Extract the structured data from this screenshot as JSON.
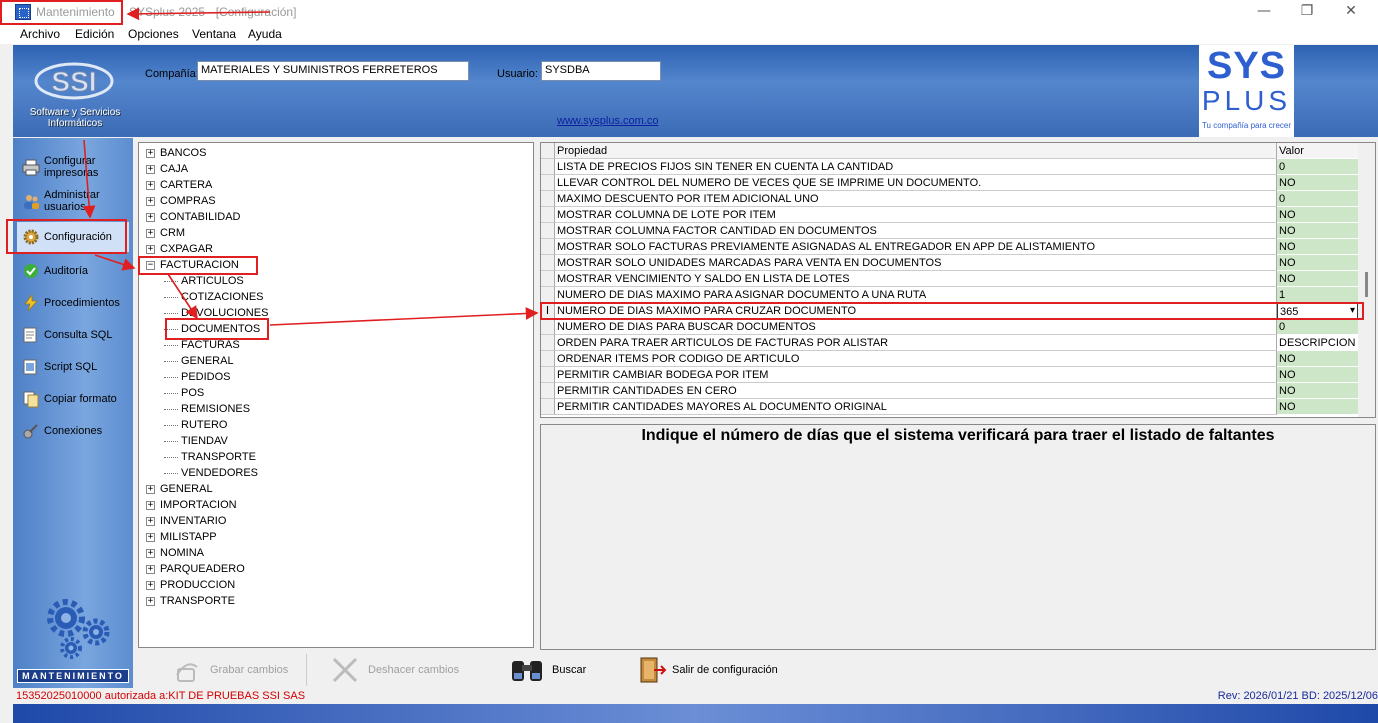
{
  "window": {
    "title_app": "Mantenimiento",
    "title_rest": "SYSplus 2025 - [Configuración]",
    "minimize": "—",
    "maximize": "❐",
    "close": "✕"
  },
  "menu": [
    "Archivo",
    "Edición",
    "Opciones",
    "Ventana",
    "Ayuda"
  ],
  "header": {
    "company_label": "Compañía:",
    "company_value": "MATERIALES Y SUMINISTROS FERRETEROS",
    "user_label": "Usuario:",
    "user_value": "SYSDBA",
    "website": "www.sysplus.com.co",
    "ssi_text1": "Software y Servicios",
    "ssi_text2": "Informáticos",
    "sys_logo_top": "SYS",
    "sys_logo_bottom": "PLUS",
    "sys_tagline": "Tu compañía para crecer"
  },
  "sidebar": {
    "items": [
      {
        "label": "Configurar impresoras",
        "icon": "printer-icon"
      },
      {
        "label": "Administrar usuarios",
        "icon": "users-icon"
      },
      {
        "label": "Configuración",
        "icon": "gear-icon"
      },
      {
        "label": "Auditoría",
        "icon": "check-icon"
      },
      {
        "label": "Procedimientos",
        "icon": "lightning-icon"
      },
      {
        "label": "Consulta SQL",
        "icon": "sql-query-icon"
      },
      {
        "label": "Script SQL",
        "icon": "script-icon"
      },
      {
        "label": "Copiar formato",
        "icon": "copy-format-icon"
      },
      {
        "label": "Conexiones",
        "icon": "connections-icon"
      }
    ],
    "footer_label": "MANTENIMIENTO"
  },
  "tree": {
    "nodes": [
      {
        "label": "BANCOS",
        "level": 0,
        "expander": "+"
      },
      {
        "label": "CAJA",
        "level": 0,
        "expander": "+"
      },
      {
        "label": "CARTERA",
        "level": 0,
        "expander": "+"
      },
      {
        "label": "COMPRAS",
        "level": 0,
        "expander": "+"
      },
      {
        "label": "CONTABILIDAD",
        "level": 0,
        "expander": "+"
      },
      {
        "label": "CRM",
        "level": 0,
        "expander": "+"
      },
      {
        "label": "CXPAGAR",
        "level": 0,
        "expander": "+"
      },
      {
        "label": "FACTURACION",
        "level": 0,
        "expander": "−"
      },
      {
        "label": "ARTICULOS",
        "level": 1,
        "expander": ""
      },
      {
        "label": "COTIZACIONES",
        "level": 1,
        "expander": ""
      },
      {
        "label": "DEVOLUCIONES",
        "level": 1,
        "expander": ""
      },
      {
        "label": "DOCUMENTOS",
        "level": 1,
        "expander": ""
      },
      {
        "label": "FACTURAS",
        "level": 1,
        "expander": ""
      },
      {
        "label": "GENERAL",
        "level": 1,
        "expander": ""
      },
      {
        "label": "PEDIDOS",
        "level": 1,
        "expander": ""
      },
      {
        "label": "POS",
        "level": 1,
        "expander": ""
      },
      {
        "label": "REMISIONES",
        "level": 1,
        "expander": ""
      },
      {
        "label": "RUTERO",
        "level": 1,
        "expander": ""
      },
      {
        "label": "TIENDAV",
        "level": 1,
        "expander": ""
      },
      {
        "label": "TRANSPORTE",
        "level": 1,
        "expander": ""
      },
      {
        "label": "VENDEDORES",
        "level": 1,
        "expander": ""
      },
      {
        "label": "GENERAL",
        "level": 0,
        "expander": "+"
      },
      {
        "label": "IMPORTACION",
        "level": 0,
        "expander": "+"
      },
      {
        "label": "INVENTARIO",
        "level": 0,
        "expander": "+"
      },
      {
        "label": "MILISTAPP",
        "level": 0,
        "expander": "+"
      },
      {
        "label": "NOMINA",
        "level": 0,
        "expander": "+"
      },
      {
        "label": "PARQUEADERO",
        "level": 0,
        "expander": "+"
      },
      {
        "label": "PRODUCCION",
        "level": 0,
        "expander": "+"
      },
      {
        "label": "TRANSPORTE",
        "level": 0,
        "expander": "+"
      }
    ]
  },
  "grid": {
    "col_property": "Propiedad",
    "col_value": "Valor",
    "current_row_marker": "I",
    "rows": [
      {
        "property": "LISTA DE PRECIOS FIJOS SIN TENER EN CUENTA LA CANTIDAD",
        "value": "0"
      },
      {
        "property": "LLEVAR CONTROL DEL NUMERO DE VECES QUE SE IMPRIME UN DOCUMENTO.",
        "value": "NO"
      },
      {
        "property": "MAXIMO DESCUENTO POR ITEM ADICIONAL UNO",
        "value": "0"
      },
      {
        "property": "MOSTRAR COLUMNA DE LOTE POR ITEM",
        "value": "NO"
      },
      {
        "property": "MOSTRAR COLUMNA FACTOR CANTIDAD EN DOCUMENTOS",
        "value": "NO"
      },
      {
        "property": "MOSTRAR SOLO FACTURAS PREVIAMENTE ASIGNADAS AL ENTREGADOR EN APP DE ALISTAMIENTO",
        "value": "NO"
      },
      {
        "property": "MOSTRAR SOLO UNIDADES MARCADAS PARA VENTA EN DOCUMENTOS",
        "value": "NO"
      },
      {
        "property": "MOSTRAR VENCIMIENTO Y SALDO EN LISTA DE LOTES",
        "value": "NO"
      },
      {
        "property": "NUMERO DE DIAS MAXIMO PARA ASIGNAR DOCUMENTO A UNA RUTA",
        "value": "1"
      },
      {
        "property": "NUMERO DE DIAS MAXIMO PARA CRUZAR DOCUMENTO",
        "value": "365"
      },
      {
        "property": "NUMERO DE DIAS PARA BUSCAR DOCUMENTOS",
        "value": "0"
      },
      {
        "property": "ORDEN PARA TRAER ARTICULOS DE FACTURAS POR ALISTAR",
        "value": "DESCRIPCION"
      },
      {
        "property": "ORDENAR ITEMS POR CODIGO DE ARTICULO",
        "value": "NO"
      },
      {
        "property": "PERMITIR CAMBIAR BODEGA POR ITEM",
        "value": "NO"
      },
      {
        "property": "PERMITIR CANTIDADES EN CERO",
        "value": "NO"
      },
      {
        "property": "PERMITIR CANTIDADES MAYORES AL DOCUMENTO ORIGINAL",
        "value": "NO"
      }
    ],
    "dropdown_arrow": "▾"
  },
  "description": "Indique el número de días que el sistema verificará para traer el listado de faltantes",
  "toolbar": {
    "save": "Grabar cambios",
    "undo": "Deshacer cambios",
    "search": "Buscar",
    "exit": "Salir de configuración"
  },
  "status": {
    "left": "15352025010000 autorizada a:KIT DE PRUEBAS SSI SAS",
    "right": "Rev: 2026/01/21 BD: 2025/12/06"
  },
  "colors": {
    "header_blue": "#3c6bb6",
    "value_green": "#cde6c7",
    "annotation_red": "#e02020",
    "status_red": "#d40000"
  }
}
